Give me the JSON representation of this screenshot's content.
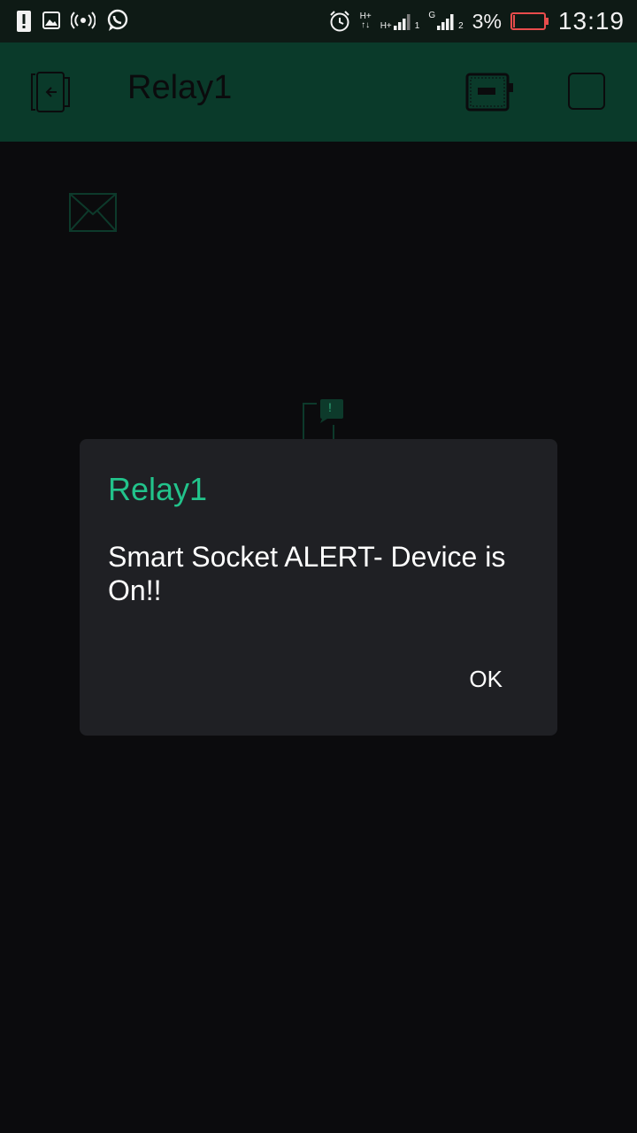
{
  "status_bar": {
    "time": "13:19",
    "battery_percent": "3%",
    "network_1": "H+",
    "network_2": "H+",
    "network_3": "G",
    "sim_1": "1",
    "sim_2": "2",
    "icons": [
      "alert-icon",
      "image-icon",
      "hotspot-icon",
      "whatsapp-icon",
      "alarm-icon",
      "signal-icon",
      "battery-icon"
    ],
    "battery_color": "#e84c4c"
  },
  "appbar": {
    "title": "Relay1",
    "color": "#0a3a2a"
  },
  "dialog": {
    "title": "Relay1",
    "message": "Smart Socket ALERT- Device is On!!",
    "ok_label": "OK",
    "accent": "#22c38b"
  },
  "widgets": {
    "notification_badge": "!"
  }
}
